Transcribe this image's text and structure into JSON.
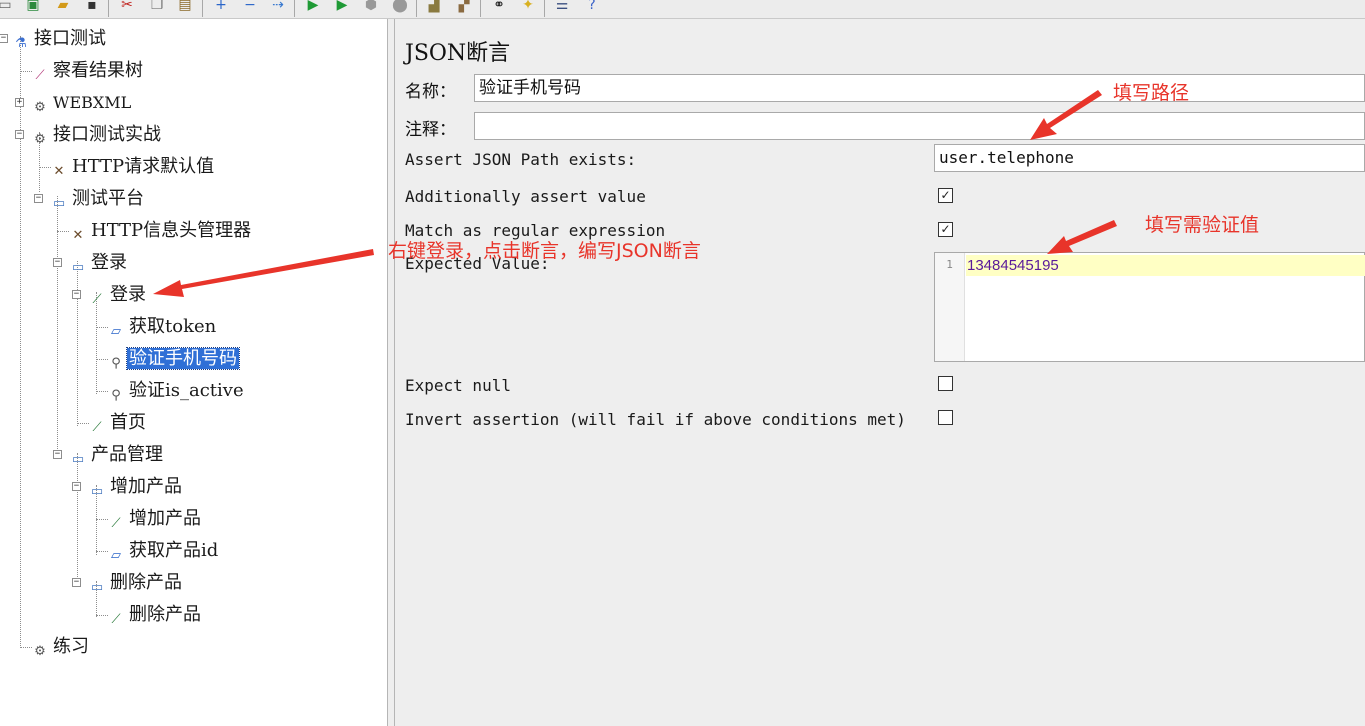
{
  "toolbar": {
    "icons": [
      "new-icon",
      "template-icon",
      "open-icon",
      "save-icon",
      "cut-icon",
      "copy-icon",
      "paste-icon",
      "expand-icon",
      "collapse-icon",
      "toggle-icon",
      "start-icon",
      "start-no-pause-icon",
      "stop-icon",
      "shutdown-icon",
      "clear-icon",
      "clear-all-icon",
      "search-icon",
      "reset-search-icon",
      "function-helper-icon",
      "help-icon"
    ]
  },
  "tree": {
    "root": "接口测试",
    "view_results": "察看结果树",
    "webxml": "WEBXML",
    "api_practice": "接口测试实战",
    "http_defaults": "HTTP请求默认值",
    "test_platform": "测试平台",
    "http_header_manager": "HTTP信息头管理器",
    "login_controller": "登录",
    "login_sampler": "登录",
    "get_token": "获取token",
    "verify_phone": "验证手机号码",
    "verify_is_active": "验证is_active",
    "home": "首页",
    "product_mgmt": "产品管理",
    "add_product_controller": "增加产品",
    "add_product_sampler": "增加产品",
    "get_product_id": "获取产品id",
    "delete_product_controller": "删除产品",
    "delete_product_sampler": "删除产品",
    "practice": "练习"
  },
  "panel": {
    "title": "JSON断言",
    "name_label": "名称：",
    "name_value": "验证手机号码",
    "comment_label": "注释：",
    "comment_value": "",
    "path_label": "Assert JSON Path exists:",
    "path_value": "user.telephone",
    "additionally_label": "Additionally assert value",
    "additionally_checked": true,
    "regex_label": "Match as regular expression",
    "regex_checked": true,
    "expected_label": "Expected Value:",
    "expected_line_number": "1",
    "expected_value": "13484545195",
    "expect_null_label": "Expect null",
    "expect_null_checked": false,
    "invert_label": "Invert assertion (will fail if above conditions met)",
    "invert_checked": false
  },
  "annotations": {
    "fill_path": "填写路径",
    "fill_value": "填写需验证值",
    "right_click_note": "右键登录，点击断言，编写JSON断言"
  },
  "colors": {
    "annotation": "#e8342a",
    "selection": "#2f6fd6",
    "editor_highlight": "#ffffc4",
    "editor_text": "#5a1a9a"
  }
}
